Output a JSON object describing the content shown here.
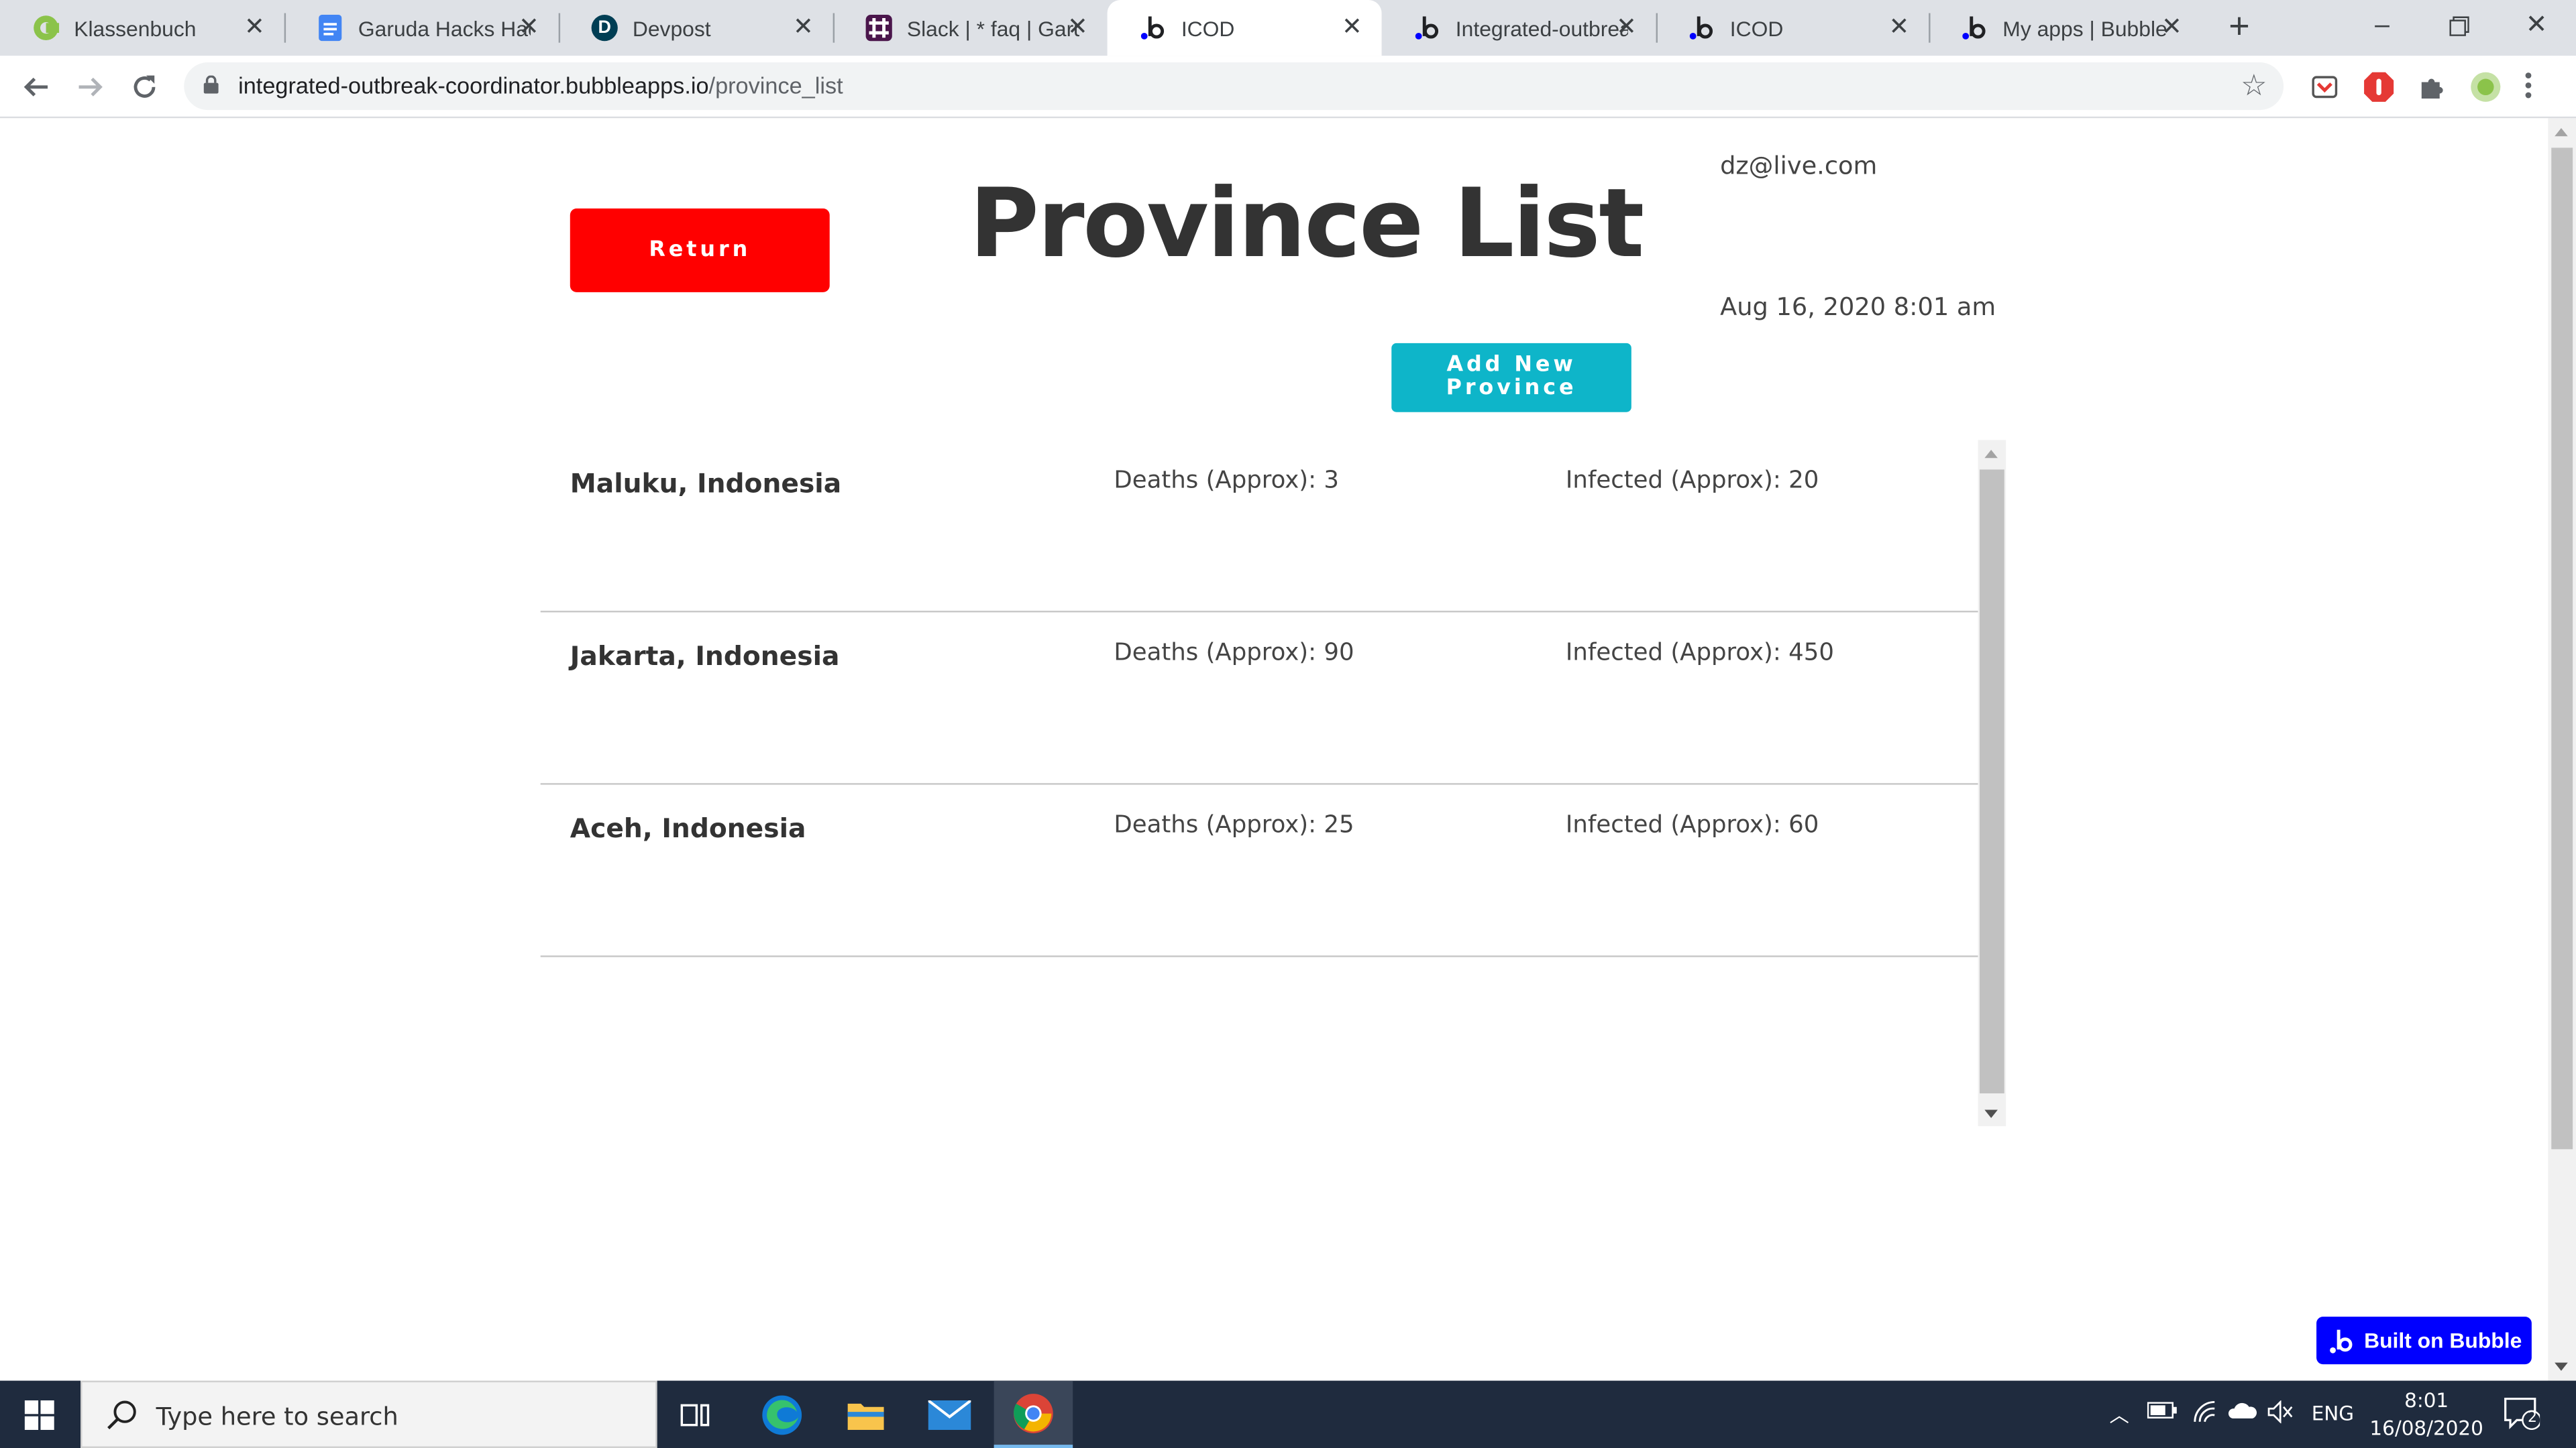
{
  "browser": {
    "tabs": [
      {
        "title": "Klassenbuch",
        "favicon": "klassenbuch-icon",
        "color": "#8bc34a",
        "active": false
      },
      {
        "title": "Garuda Hacks Hac",
        "favicon": "google-docs-icon",
        "color": "#4285f4",
        "active": false
      },
      {
        "title": "Devpost",
        "favicon": "devpost-icon",
        "glyph": "D",
        "color": "#003e54",
        "active": false
      },
      {
        "title": "Slack | * faq | Garu",
        "favicon": "slack-icon",
        "color": "#4a154b",
        "active": false
      },
      {
        "title": "ICOD",
        "favicon": "bubble-icon",
        "glyph": ".b",
        "color": "#0000ff",
        "active": true
      },
      {
        "title": "Integrated-outbrea",
        "favicon": "bubble-icon",
        "glyph": ".b",
        "color": "#0000ff",
        "active": false
      },
      {
        "title": "ICOD",
        "favicon": "bubble-icon",
        "glyph": ".b",
        "color": "#0000ff",
        "active": false
      },
      {
        "title": "My apps | Bubble",
        "favicon": "bubble-icon",
        "glyph": ".b",
        "color": "#0000ff",
        "active": false
      }
    ],
    "url_host": "integrated-outbreak-coordinator.bubbleapps.io",
    "url_path": "/province_list"
  },
  "page": {
    "title": "Province List",
    "return_label": "Return",
    "user_email": "dz@live.com",
    "timestamp": "Aug 16, 2020 8:01 am",
    "add_button_line1": "Add New",
    "add_button_line2": "Province",
    "provinces": [
      {
        "name": "Maluku, Indonesia",
        "deaths": "Deaths (Approx): 3",
        "infected": "Infected (Approx): 20"
      },
      {
        "name": "Jakarta, Indonesia",
        "deaths": "Deaths (Approx): 90",
        "infected": "Infected (Approx): 450"
      },
      {
        "name": "Aceh, Indonesia",
        "deaths": "Deaths (Approx): 25",
        "infected": "Infected (Approx): 60"
      }
    ],
    "badge_label": "Built on Bubble"
  },
  "taskbar": {
    "search_placeholder": "Type here to search",
    "language": "ENG",
    "time": "8:01",
    "date": "16/08/2020",
    "notification_count": "2"
  },
  "colors": {
    "return_button": "#ff0000",
    "add_button": "#0eb5c9",
    "bubble_blue": "#0000ff",
    "taskbar": "#1f2b3e"
  }
}
